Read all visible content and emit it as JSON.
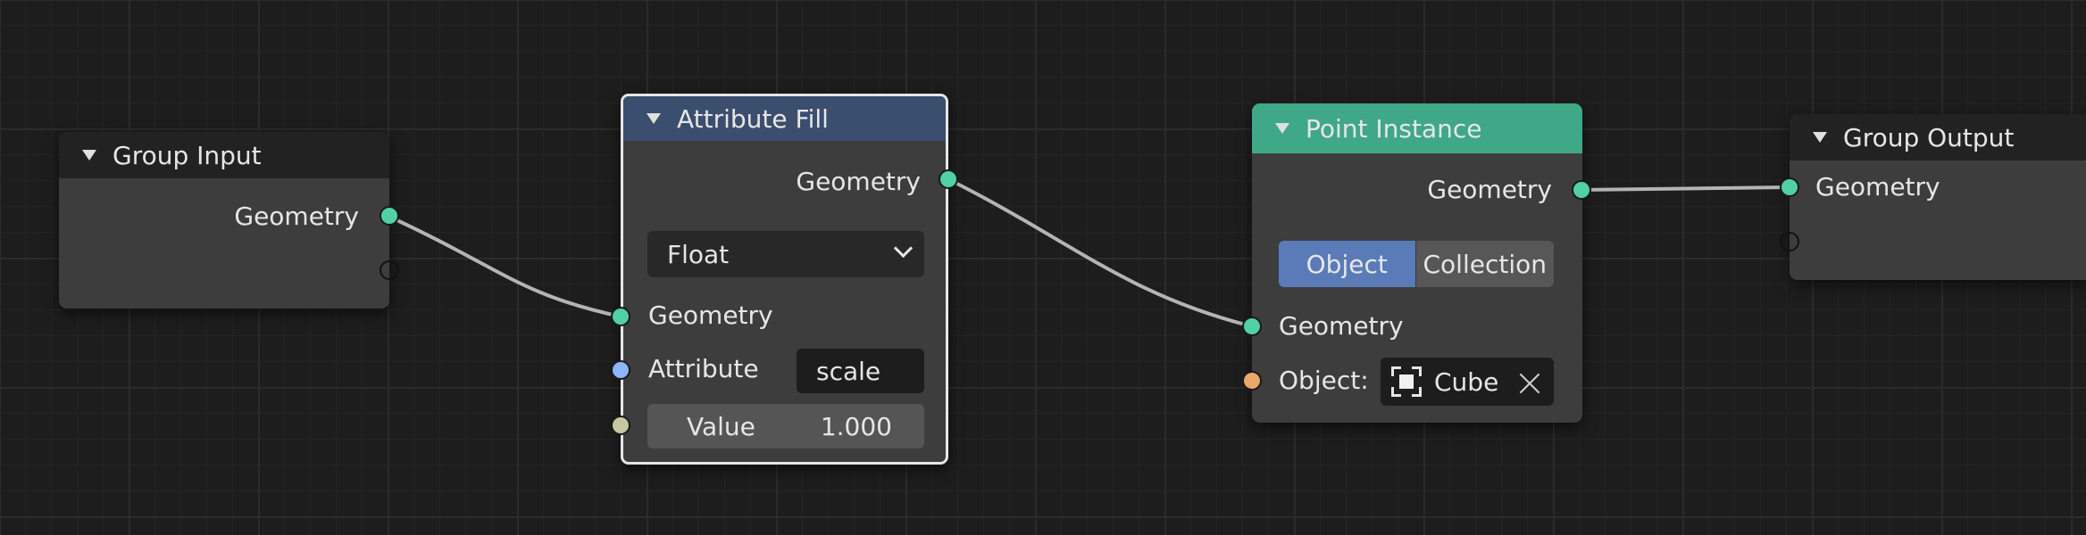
{
  "colors": {
    "geometry_socket": "#4fd1a5",
    "attribute_socket": "#8fb4ff",
    "value_socket": "#c8c8a0",
    "object_socket": "#e8a86a",
    "attribute_fill_header": "#3a4e6e",
    "point_instance_header": "#3fa887",
    "group_header": "#222222",
    "link": "#b4b4b4"
  },
  "nodes": {
    "group_input": {
      "title": "Group Input",
      "outputs": [
        "Geometry"
      ]
    },
    "attribute_fill": {
      "title": "Attribute Fill",
      "output_label": "Geometry",
      "type_dropdown": "Float",
      "input_geometry_label": "Geometry",
      "attribute_label": "Attribute",
      "attribute_value": "scale",
      "value_label": "Value",
      "value_number": "1.000"
    },
    "point_instance": {
      "title": "Point Instance",
      "output_label": "Geometry",
      "mode_object": "Object",
      "mode_collection": "Collection",
      "input_geometry_label": "Geometry",
      "object_label": "Object:",
      "object_value": "Cube"
    },
    "group_output": {
      "title": "Group Output",
      "input_label": "Geometry"
    }
  }
}
